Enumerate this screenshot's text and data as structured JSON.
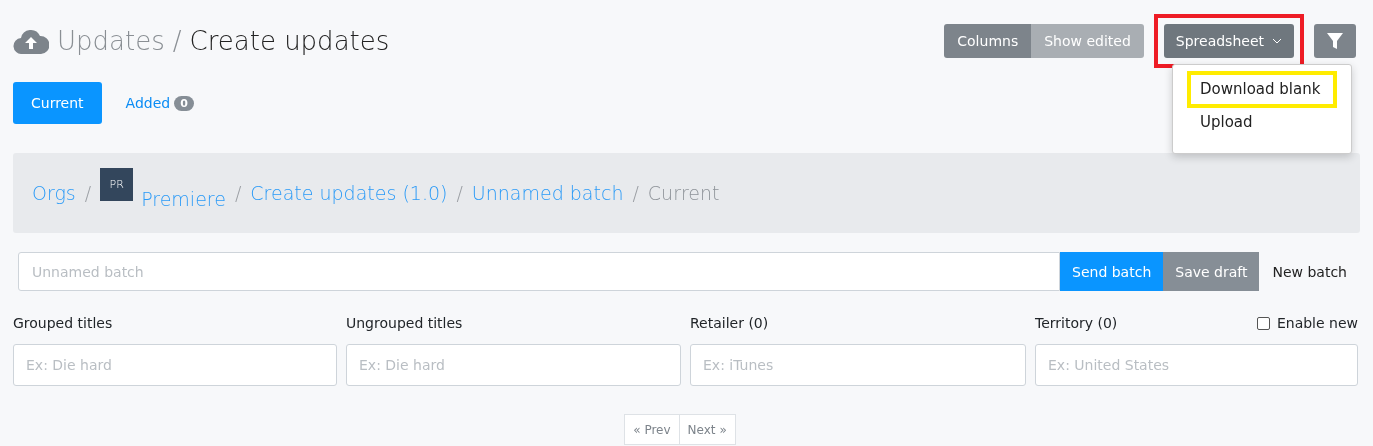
{
  "header": {
    "section": "Updates",
    "separator": "/",
    "title": "Create updates"
  },
  "toolbar": {
    "buttons": [
      {
        "label": "Columns",
        "selected": true
      },
      {
        "label": "Show edited",
        "selected": false
      }
    ],
    "spreadsheet": {
      "label": "Spreadsheet",
      "highlighted": true,
      "expanded": true
    }
  },
  "dropdown": {
    "items": [
      {
        "label": "Download blank",
        "highlighted": true
      },
      {
        "label": "Upload",
        "highlighted": false
      }
    ]
  },
  "tabs": [
    {
      "label": "Current",
      "selected": true
    },
    {
      "label": "Added",
      "count": "0",
      "selected": false
    }
  ],
  "breadcrumb": [
    {
      "label": "Orgs",
      "kind": "link"
    },
    {
      "separator": "/",
      "label": "Premiere",
      "kind": "org",
      "avatar": "PR"
    },
    {
      "separator": "/",
      "label": "Create updates (1.0)",
      "kind": "link"
    },
    {
      "separator": "/",
      "label": "Unnamed batch",
      "kind": "link"
    },
    {
      "separator": "/",
      "label": "Current",
      "kind": "current"
    }
  ],
  "batch": {
    "placeholder": "Unnamed batch",
    "buttons": [
      {
        "label": "Send batch",
        "kind": "primary"
      },
      {
        "label": "Save draft",
        "kind": "secondary"
      },
      {
        "label": "New batch",
        "kind": "plain"
      }
    ]
  },
  "filters": [
    {
      "label": "Grouped titles",
      "placeholder": "Ex: Die hard"
    },
    {
      "label": "Ungrouped titles",
      "placeholder": "Ex: Die hard"
    },
    {
      "label": "Retailer (0)",
      "placeholder": "Ex: iTunes"
    },
    {
      "label": "Territory (0)",
      "placeholder": "Ex: United States",
      "option": {
        "label": "Enable new",
        "checked": false
      }
    }
  ],
  "pagination": [
    "« Prev",
    "Next »"
  ]
}
